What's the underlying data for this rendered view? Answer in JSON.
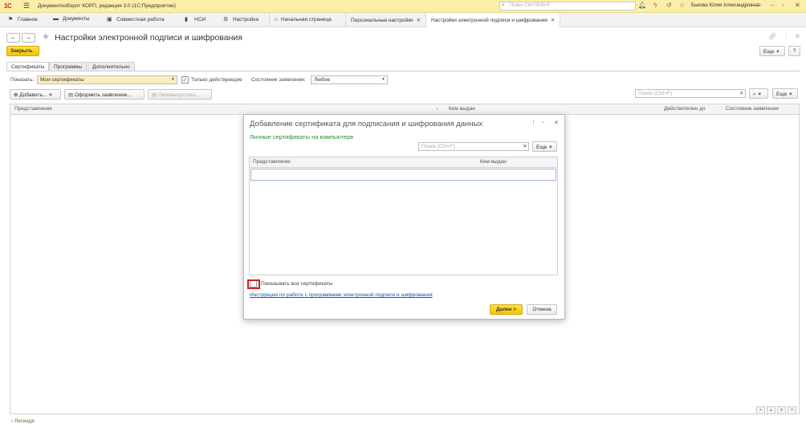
{
  "titlebar": {
    "logo": "1С",
    "app_title": "Документооборот КОРП, редакция 3.0  (1С:Предприятие)",
    "search_placeholder": "Поиск Ctrl+Shift+F",
    "user": "Быкова Юлия Александровна"
  },
  "sections": [
    {
      "label": "Главное",
      "icon": "flag-icon"
    },
    {
      "label": "Документы",
      "icon": "folder-icon"
    },
    {
      "label": "Совместная работа",
      "icon": "briefcase-icon"
    },
    {
      "label": "НСИ",
      "icon": "book-icon"
    },
    {
      "label": "Настройка",
      "icon": "gear-icon"
    }
  ],
  "open_tabs": [
    {
      "label": "Начальная страница",
      "closable": false
    },
    {
      "label": "Персональные настройки",
      "closable": true
    },
    {
      "label": "Настройки электронной подписи и шифрования",
      "closable": true
    }
  ],
  "form": {
    "title": "Настройки электронной подписи и шифрования",
    "close_button": "Закрыть",
    "more_button": "Еще",
    "help_button": "?"
  },
  "tabs": [
    "Сертификаты",
    "Программы",
    "Дополнительно"
  ],
  "filter": {
    "show_label": "Показать:",
    "show_value": "Мои сертификаты",
    "only_valid_label": "Только действующие",
    "only_valid_checked": true,
    "status_label": "Состояние заявления:",
    "status_value": "Любое"
  },
  "toolbar": {
    "add": "Добавить...",
    "apply": "Оформить заявление...",
    "reissue": "Перевыпустить...",
    "search_placeholder": "Поиск (Ctrl+F)",
    "more": "Еще"
  },
  "table": {
    "columns": [
      "Представление",
      "Кем выдан",
      "Действителен до",
      "Состояние заявления"
    ],
    "sort_indicator": "↓"
  },
  "legend": "Легенда",
  "dialog": {
    "title": "Добавление сертификата для подписания и шифрования данных",
    "subtitle": "Личные сертификаты на компьютере",
    "search_placeholder": "Поиск (Ctrl+F)",
    "more": "Еще",
    "columns": [
      "Представление",
      "Кем выдан"
    ],
    "show_all_label": "Показывать все сертификаты",
    "show_all_checked": false,
    "instructions_link": "Инструкции по работе с программами электронной подписи и шифрования",
    "next_button": "Далее >",
    "cancel_button": "Отмена"
  },
  "colors": {
    "titlebar_bg": "#fbeea9",
    "accent_yellow": "#f4c400",
    "green_text": "#2e8b2e",
    "link_blue": "#1a4fbf",
    "highlight_red": "#d12020"
  }
}
